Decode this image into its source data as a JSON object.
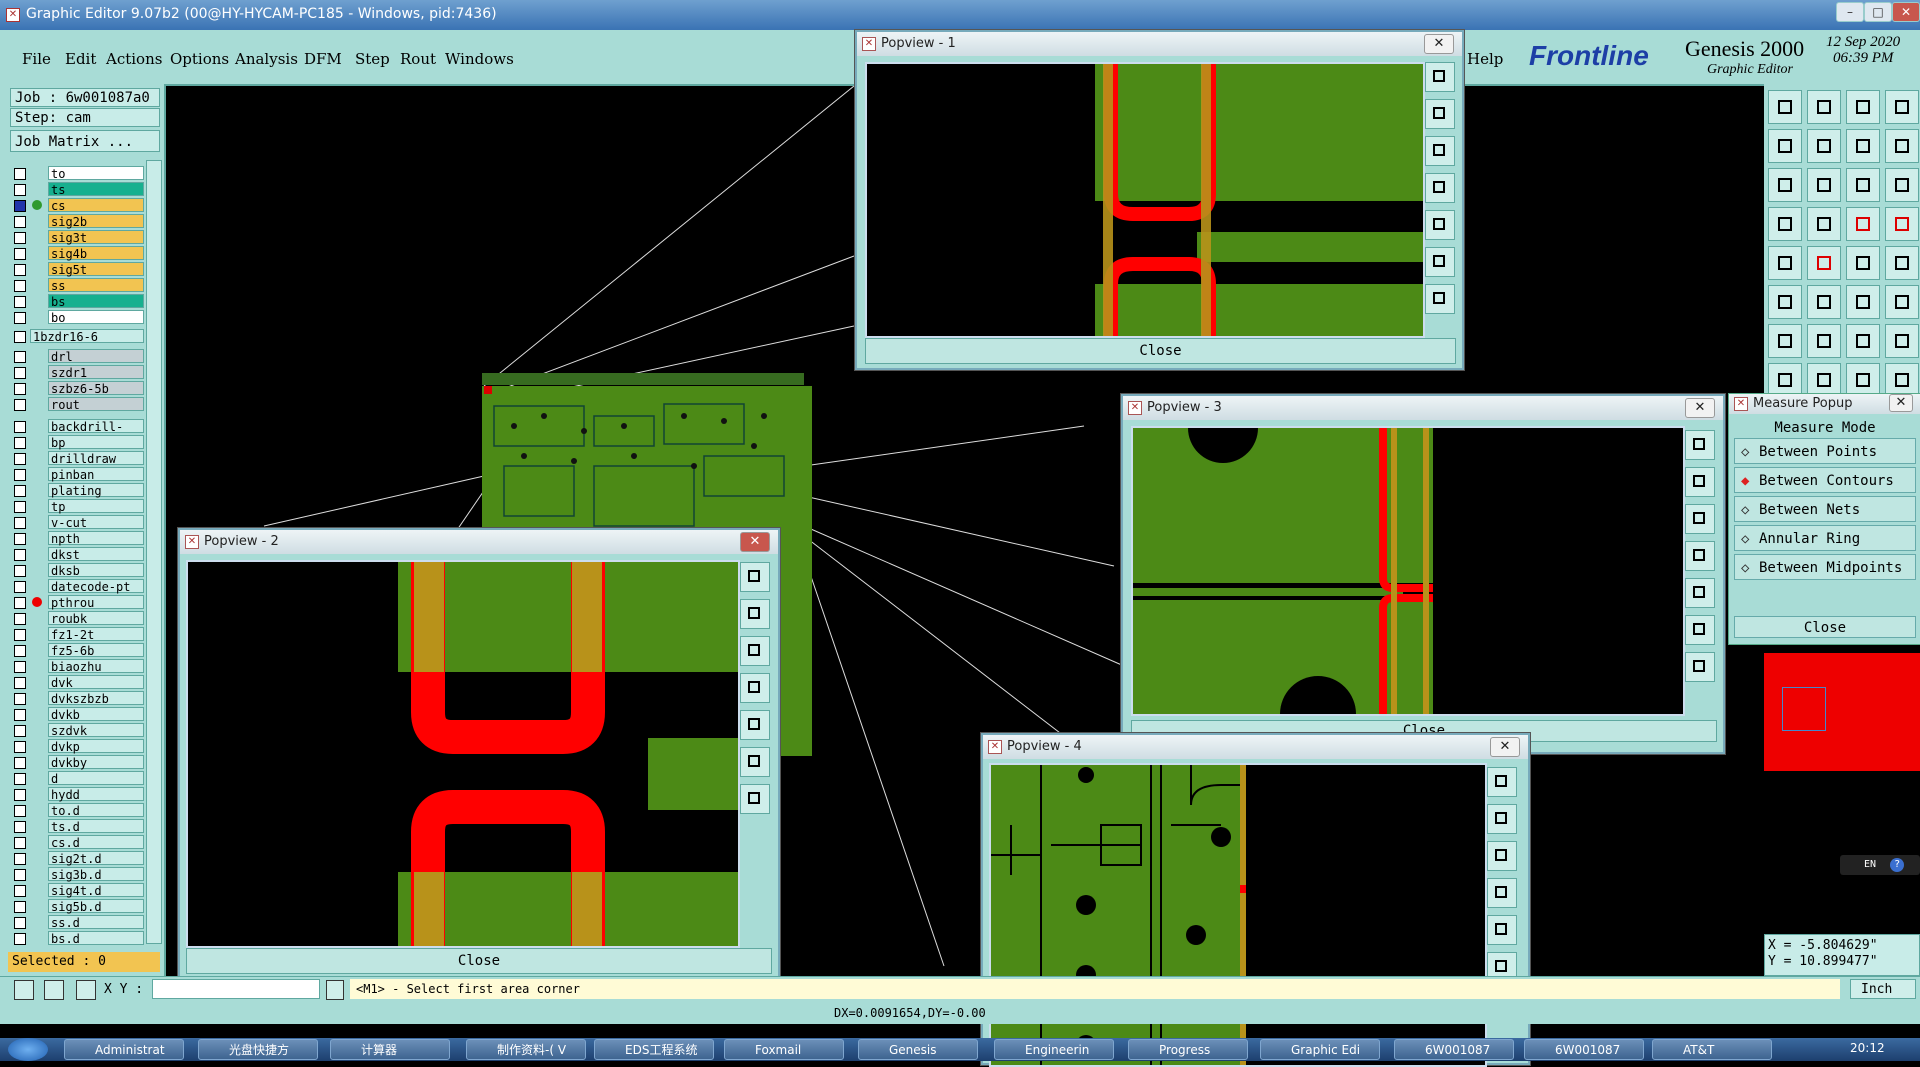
{
  "window": {
    "title": "Graphic Editor 9.07b2 (00@HY-HYCAM-PC185 - Windows, pid:7436)"
  },
  "menu": [
    "File",
    "Edit",
    "Actions",
    "Options",
    "Analysis",
    "DFM",
    "Step",
    "Rout",
    "Windows"
  ],
  "help": "Help",
  "brand": {
    "logo": "Frontline",
    "product": "Genesis 2000",
    "subtitle": "Graphic Editor",
    "date": "12 Sep 2020",
    "time": "06:39 PM"
  },
  "job": {
    "job": "Job : 6w001087a0",
    "step": "Step: cam",
    "matrix": "Job Matrix ..."
  },
  "layers_group1": [
    {
      "name": "to",
      "color": "#ffffff"
    },
    {
      "name": "ts",
      "color": "#17b08f"
    },
    {
      "name": "cs",
      "color": "#f2c451"
    },
    {
      "name": "sig2b",
      "color": "#f2c451"
    },
    {
      "name": "sig3t",
      "color": "#f2c451"
    },
    {
      "name": "sig4b",
      "color": "#f2c451"
    },
    {
      "name": "sig5t",
      "color": "#f2c451"
    },
    {
      "name": "ss",
      "color": "#f2c451"
    },
    {
      "name": "bs",
      "color": "#17b08f"
    },
    {
      "name": "bo",
      "color": "#ffffff"
    }
  ],
  "layer_single": "1bzdr16-6",
  "layers_group2": [
    "drl",
    "szdr1",
    "szbz6-5b",
    "rout"
  ],
  "layers_group3": [
    "backdrill-",
    "bp",
    "drilldraw",
    "pinban",
    "plating",
    "tp",
    "v-cut",
    "npth",
    "dkst",
    "dksb",
    "datecode-pt",
    "pthrou",
    "roubk",
    "fz1-2t",
    "fz5-6b",
    "biaozhu",
    "dvk",
    "dvkszbzb",
    "dvkb",
    "szdvk",
    "dvkp",
    "dvkby",
    "d",
    "hydd",
    "to.d",
    "ts.d",
    "cs.d",
    "sig2t.d",
    "sig3b.d",
    "sig4t.d",
    "sig5b.d",
    "ss.d",
    "bs.d"
  ],
  "selected": "Selected : 0",
  "popups": {
    "p1": {
      "title": "Popview - 1",
      "close": "Close"
    },
    "p2": {
      "title": "Popview - 2",
      "close": "Close"
    },
    "p3": {
      "title": "Popview - 3",
      "close": "Close"
    },
    "p4": {
      "title": "Popview - 4"
    }
  },
  "measure": {
    "title": "Measure Popup",
    "heading": "Measure Mode",
    "options": [
      "Between Points",
      "Between Contours",
      "Between Nets",
      "Annular Ring",
      "Between Midpoints"
    ],
    "selected": "Between Contours",
    "close": "Close"
  },
  "coords": {
    "x": "X = -5.804629\"",
    "y": "Y = 10.899477\""
  },
  "command": {
    "xy_label": "X Y :",
    "prompt": "<M1> - Select first area corner",
    "units": "Inch"
  },
  "status": {
    "delta": "DX=0.0091654,DY=-0.00"
  },
  "ime": "EN",
  "taskbar": [
    "Administrat",
    "光盘快捷方",
    "计算器",
    "制作资料-( V",
    "EDS工程系统",
    "Foxmail",
    "Genesis",
    "Engineerin",
    "Progress",
    "Graphic Edi",
    "6W001087",
    "6W001087",
    "AT&T"
  ],
  "clock": "20:12"
}
